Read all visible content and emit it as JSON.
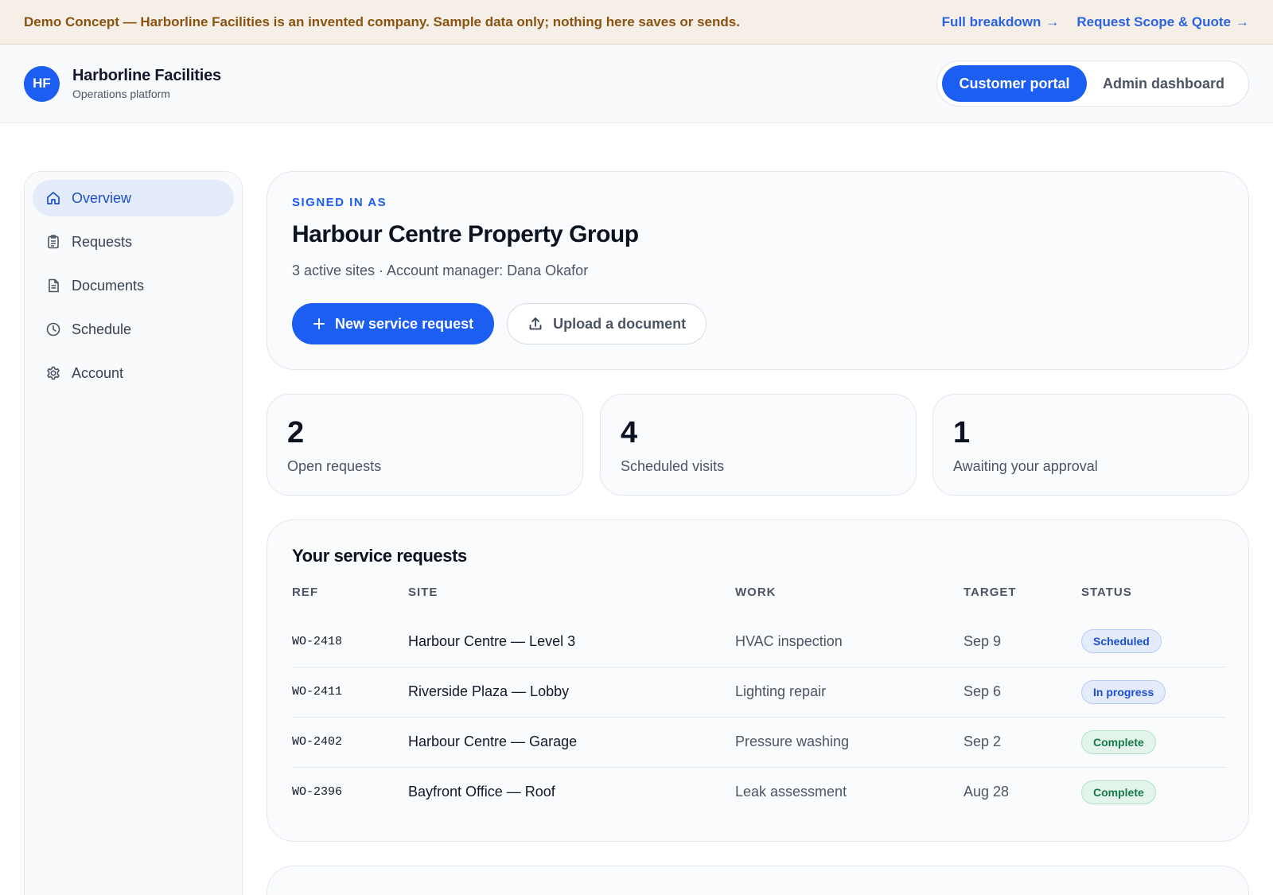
{
  "banner": {
    "text": "Demo Concept — Harborline Facilities is an invented company. Sample data only; nothing here saves or sends.",
    "links": [
      {
        "label": "Full breakdown",
        "arrow": "→"
      },
      {
        "label": "Request Scope & Quote",
        "arrow": "→"
      }
    ]
  },
  "header": {
    "logo_initials": "HF",
    "brand_name": "Harborline Facilities",
    "brand_subtitle": "Operations platform",
    "toggle": {
      "active": "Customer portal",
      "inactive": "Admin dashboard"
    }
  },
  "sidebar": {
    "items": [
      {
        "label": "Overview",
        "icon": "home-icon",
        "active": true
      },
      {
        "label": "Requests",
        "icon": "clipboard-icon",
        "active": false
      },
      {
        "label": "Documents",
        "icon": "document-icon",
        "active": false
      },
      {
        "label": "Schedule",
        "icon": "clock-icon",
        "active": false
      },
      {
        "label": "Account",
        "icon": "gear-icon",
        "active": false
      }
    ]
  },
  "account": {
    "eyebrow": "SIGNED IN AS",
    "company": "Harbour Centre Property Group",
    "meta": "3 active sites · Account manager: Dana Okafor",
    "primary_action": "New service request",
    "secondary_action": "Upload a document"
  },
  "stats": [
    {
      "value": "2",
      "label": "Open requests"
    },
    {
      "value": "4",
      "label": "Scheduled visits"
    },
    {
      "value": "1",
      "label": "Awaiting your approval"
    }
  ],
  "requests": {
    "title": "Your service requests",
    "columns": [
      "REF",
      "SITE",
      "WORK",
      "TARGET",
      "STATUS"
    ],
    "rows": [
      {
        "ref": "WO-2418",
        "site": "Harbour Centre — Level 3",
        "work": "HVAC inspection",
        "target": "Sep 9",
        "status": "Scheduled"
      },
      {
        "ref": "WO-2411",
        "site": "Riverside Plaza — Lobby",
        "work": "Lighting repair",
        "target": "Sep 6",
        "status": "In progress"
      },
      {
        "ref": "WO-2402",
        "site": "Harbour Centre — Garage",
        "work": "Pressure washing",
        "target": "Sep 2",
        "status": "Complete"
      },
      {
        "ref": "WO-2396",
        "site": "Bayfront Office — Roof",
        "work": "Leak assessment",
        "target": "Aug 28",
        "status": "Complete"
      }
    ]
  },
  "colors": {
    "accent": "#1c5df2",
    "banner_text": "#8a5310",
    "status_blue": "#1c4fd1",
    "status_green": "#17794a"
  }
}
